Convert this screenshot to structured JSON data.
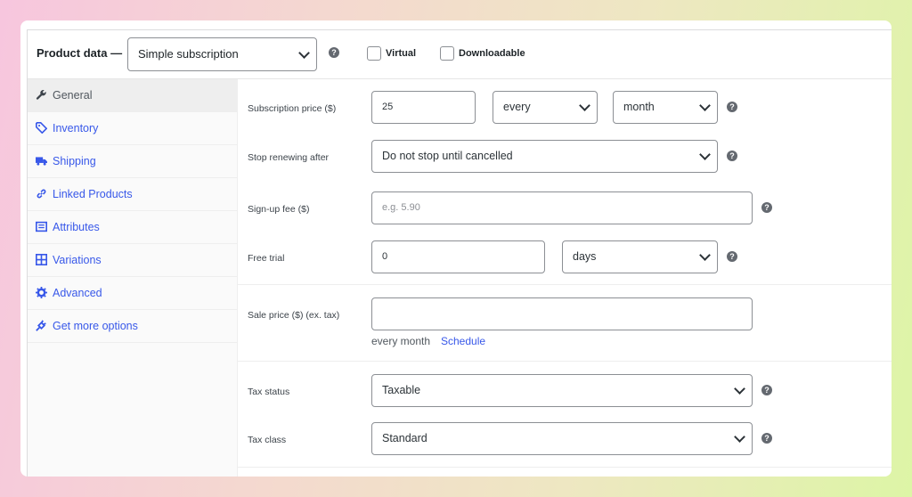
{
  "header": {
    "title": "Product data —",
    "product_type": "Simple subscription",
    "virtual_label": "Virtual",
    "downloadable_label": "Downloadable",
    "help_glyph": "?"
  },
  "sidebar": {
    "items": [
      {
        "label": "General",
        "icon": "wrench-icon",
        "active": true
      },
      {
        "label": "Inventory",
        "icon": "tag-icon"
      },
      {
        "label": "Shipping",
        "icon": "truck-icon"
      },
      {
        "label": "Linked Products",
        "icon": "link-icon"
      },
      {
        "label": "Attributes",
        "icon": "list-icon"
      },
      {
        "label": "Variations",
        "icon": "grid-icon"
      },
      {
        "label": "Advanced",
        "icon": "gear-icon"
      },
      {
        "label": "Get more options",
        "icon": "plug-icon"
      }
    ]
  },
  "fields": {
    "subscription_price": {
      "label": "Subscription price ($)",
      "value": "25",
      "interval": "every",
      "period": "month"
    },
    "stop_renewing": {
      "label": "Stop renewing after",
      "value": "Do not stop until cancelled"
    },
    "signup_fee": {
      "label": "Sign-up fee ($)",
      "placeholder": "e.g. 5.90"
    },
    "free_trial": {
      "label": "Free trial",
      "value": "0",
      "unit": "days"
    },
    "sale_price": {
      "label": "Sale price ($) (ex. tax)",
      "value": "",
      "note": "every month",
      "schedule_link": "Schedule"
    },
    "tax_status": {
      "label": "Tax status",
      "value": "Taxable"
    },
    "tax_class": {
      "label": "Tax class",
      "value": "Standard"
    }
  },
  "colors": {
    "accent": "#3858e9",
    "border": "#8c8f94",
    "active_tab": "#eeeeee"
  }
}
